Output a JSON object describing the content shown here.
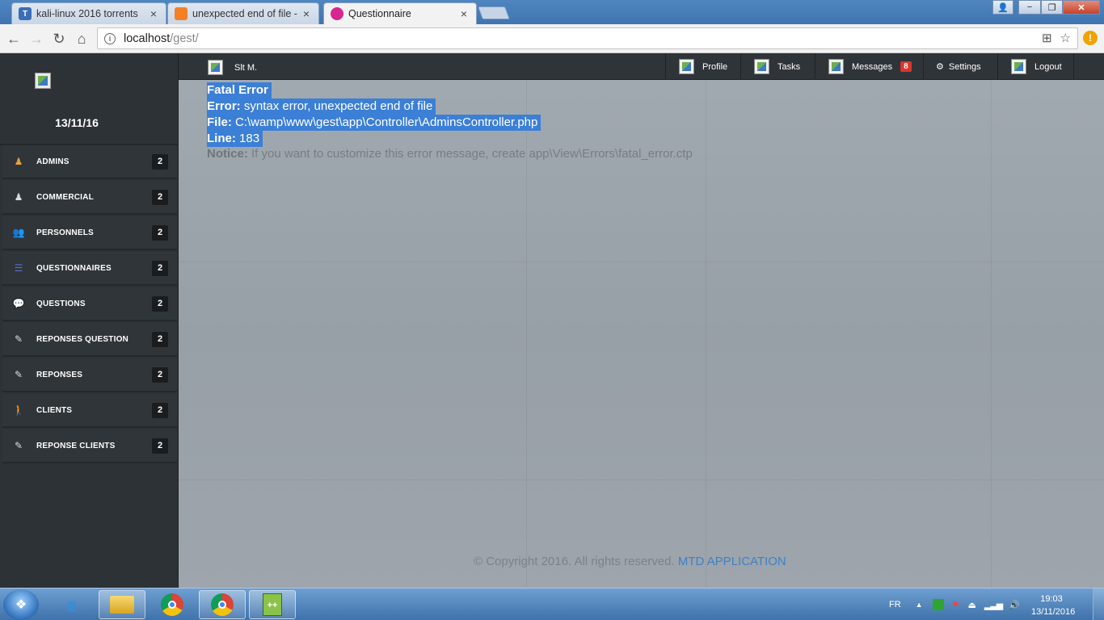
{
  "browser": {
    "tabs": [
      {
        "label": "kali-linux 2016 torrents",
        "favicon": "T2",
        "active": false
      },
      {
        "label": "unexpected end of file -",
        "favicon": "stack-icon",
        "active": false
      },
      {
        "label": "Questionnaire",
        "favicon": "cake-icon",
        "active": true
      }
    ],
    "close_glyph": "×",
    "url_host": "localhost",
    "url_path": "/gest/",
    "window_controls": [
      "−",
      "❐",
      "✕"
    ]
  },
  "app": {
    "date": "13/11/16",
    "user_name": "Slt M.",
    "nav": [
      {
        "label": "Profile"
      },
      {
        "label": "Tasks"
      },
      {
        "label": "Messages",
        "badge": "8"
      },
      {
        "label": "Settings"
      },
      {
        "label": "Logout"
      }
    ],
    "menu": [
      {
        "label": "ADMINS",
        "count": "2",
        "icon": "user-icon"
      },
      {
        "label": "COMMERCIAL",
        "count": "2",
        "icon": "user-icon"
      },
      {
        "label": "PERSONNELS",
        "count": "2",
        "icon": "group-icon"
      },
      {
        "label": "QUESTIONNAIRES",
        "count": "2",
        "icon": "list-icon"
      },
      {
        "label": "QUESTIONS",
        "count": "2",
        "icon": "comment-icon"
      },
      {
        "label": "REPONSES QUESTION",
        "count": "2",
        "icon": "pencil-icon"
      },
      {
        "label": "REPONSES",
        "count": "2",
        "icon": "pencil-icon"
      },
      {
        "label": "CLIENTS",
        "count": "2",
        "icon": "walking-icon"
      },
      {
        "label": "REPONSE CLIENTS",
        "count": "2",
        "icon": "pencil-icon"
      }
    ]
  },
  "error": {
    "title": "Fatal Error",
    "error_label": "Error:",
    "error_text": "syntax error, unexpected end of file",
    "file_label": "File:",
    "file_text": "C:\\wamp\\www\\gest\\app\\Controller\\AdminsController.php",
    "line_label": "Line:",
    "line_text": "183",
    "notice_label": "Notice:",
    "notice_text": "If you want to customize this error message, create app\\View\\Errors\\fatal_error.ctp"
  },
  "footer": {
    "copyright": "© Copyright 2016. All rights reserved.",
    "brand": "MTD APPLICATION"
  },
  "taskbar": {
    "language": "FR",
    "time": "19:03",
    "date": "13/11/2016"
  },
  "colors": {
    "selection": "#3c7fd6",
    "badge": "#d9362f",
    "brand_link": "#3f80c8",
    "sidebar": "#2d3236"
  }
}
